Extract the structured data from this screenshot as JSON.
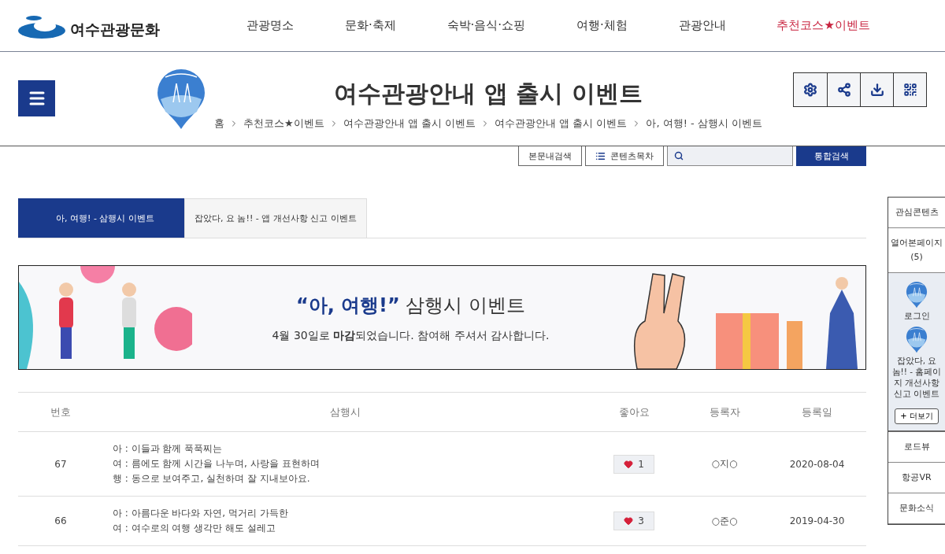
{
  "site": {
    "name": "여수관광문화"
  },
  "nav": [
    {
      "label": "관광명소",
      "selected": false
    },
    {
      "label": "문화·축제",
      "selected": false
    },
    {
      "label": "숙박·음식·쇼핑",
      "selected": false
    },
    {
      "label": "여행·체험",
      "selected": false
    },
    {
      "label": "관광안내",
      "selected": false
    },
    {
      "label": "추천코스★이벤트",
      "selected": true
    }
  ],
  "page": {
    "title": "여수관광안내 앱 출시 이벤트",
    "breadcrumb": [
      "홈",
      "추천코스★이벤트",
      "여수관광안내 앱 출시 이벤트",
      "여수관광안내 앱 출시 이벤트",
      "아, 여행! - 삼행시 이벤트"
    ]
  },
  "search": {
    "in_page_button": "본문내검색",
    "contents_button": "콘텐츠목차",
    "submit_button": "통합검색"
  },
  "tabs": [
    {
      "label": "아, 여행! - 삼행시 이벤트",
      "selected": true
    },
    {
      "label": "잡았다, 요 놈!! - 앱 개선사항 신고 이벤트",
      "selected": false
    }
  ],
  "banner": {
    "headline": "**“아, 여행!”** 삼행시 이벤트",
    "notice": "4월 30일로 **마감**되었습니다. 참여해 주셔서 감사합니다."
  },
  "table": {
    "columns": [
      "번호",
      "삼행시",
      "좋아요",
      "등록자",
      "등록일"
    ],
    "rows": [
      {
        "number": "67",
        "lines": [
          "아 : 이들과 함께 푹푹찌는",
          "여 : 름에도 함께 시간을 나누며, 사랑을 표현하며",
          "행 : 동으로 보여주고, 실천하며 잘 지내보아요."
        ],
        "likes": "1",
        "author": "○지○",
        "date": "2020-08-04"
      },
      {
        "number": "66",
        "lines": [
          "아 : 아름다운 바다와 자연, 먹거리 가득한",
          "여 : 여수로의 여행 생각만 해도 설레고"
        ],
        "likes": "3",
        "author": "○준○",
        "date": "2019-04-30"
      }
    ]
  },
  "quick_menu": {
    "items_top": [
      "관심콘텐츠",
      "열어본페이지\n(5)"
    ],
    "recent": [
      "로그인",
      "잡았다, 요 놈!! - 홈페이지 개선사항 신고 이벤트"
    ],
    "more_button": "+ 더보기",
    "items_bottom": [
      "로드뷰",
      "항공VR",
      "문화소식"
    ]
  }
}
